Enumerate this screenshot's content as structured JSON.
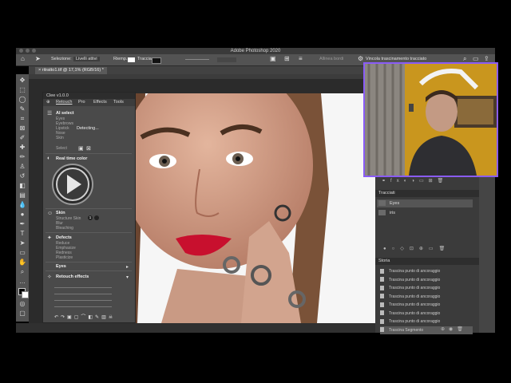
{
  "app": {
    "title": "Adobe Photoshop 2020",
    "colors": {
      "webcam_border": "#8a5cf6",
      "ui_dark": "#3a3a3a",
      "ui_mid": "#535353",
      "lips": "#c8102e"
    }
  },
  "options_bar": {
    "select_label": "Selezione:",
    "select_value": "Livelli attivi",
    "fill_label": "Riemp.:",
    "stroke_label": "Traccia:",
    "align_edges": "Allinea bordi",
    "constrain_path": "Vincola trascinamento tracciato"
  },
  "document": {
    "tab": "ritratto1.tif @ 17,1% (RGB/16) *"
  },
  "plugin": {
    "name": "Clee v1.0.0",
    "tabs": [
      "Retouch",
      "Pro",
      "Effects",
      "Tools"
    ],
    "ai_select": {
      "title": "AI select",
      "items": [
        "Eyes",
        "Eyebrows",
        "Lipstick",
        "Nose",
        "Skin"
      ],
      "status": "Detecting...",
      "select_label": "Select"
    },
    "real_time_color": "Real time color",
    "skin": {
      "title": "Skin",
      "items": [
        "Structure Skin",
        "Blur",
        "Bleaching"
      ],
      "badge": "1"
    },
    "defects": {
      "title": "Defects",
      "items": [
        "Reduce",
        "Emphasize",
        "Redness",
        "Plasticize"
      ]
    },
    "eyes": "Eyes",
    "retouch_effects": "Retouch effects"
  },
  "paths_panel": {
    "title": "Tracciati",
    "items": [
      "Eyes",
      "iris"
    ]
  },
  "history_panel": {
    "title": "Storia",
    "items": [
      "Trascina punto di ancoraggio",
      "Trascina punto di ancoraggio",
      "Trascina punto di ancoraggio",
      "Trascina punto di ancoraggio",
      "Trascina punto di ancoraggio",
      "Trascina punto di ancoraggio",
      "Trascina punto di ancoraggio",
      "Trascina Segmento"
    ]
  }
}
